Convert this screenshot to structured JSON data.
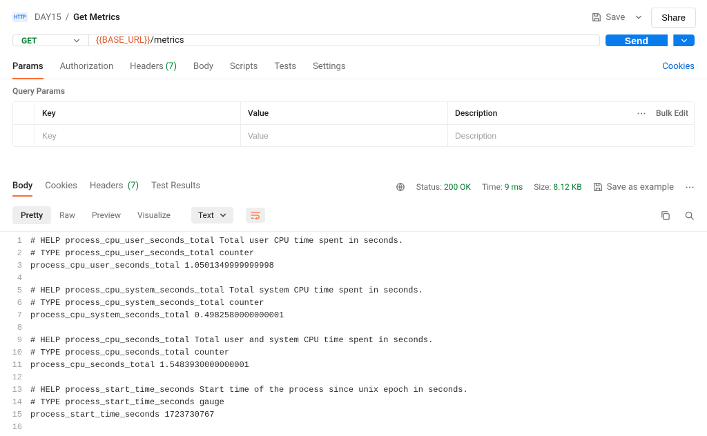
{
  "breadcrumb": {
    "parent": "DAY15",
    "current": "Get Metrics"
  },
  "top_actions": {
    "save": "Save",
    "share": "Share"
  },
  "request": {
    "method": "GET",
    "url_var": "{{BASE_URL}}",
    "url_path": "/metrics",
    "send": "Send"
  },
  "primary_tabs": {
    "params": "Params",
    "authorization": "Authorization",
    "headers": "Headers",
    "headers_count": "(7)",
    "body": "Body",
    "scripts": "Scripts",
    "tests": "Tests",
    "settings": "Settings"
  },
  "cookies_link": "Cookies",
  "qp": {
    "heading": "Query Params",
    "key": "Key",
    "value": "Value",
    "description": "Description",
    "bulk_edit": "Bulk Edit",
    "ph_key": "Key",
    "ph_value": "Value",
    "ph_desc": "Description"
  },
  "response_tabs": {
    "body": "Body",
    "cookies": "Cookies",
    "headers": "Headers",
    "headers_count": "(7)",
    "test_results": "Test Results"
  },
  "response_meta": {
    "status_label": "Status:",
    "status_value": "200 OK",
    "time_label": "Time:",
    "time_value": "9 ms",
    "size_label": "Size:",
    "size_value": "8.12 KB",
    "save_example": "Save as example"
  },
  "response_toolbar": {
    "pretty": "Pretty",
    "raw": "Raw",
    "preview": "Preview",
    "visualize": "Visualize",
    "mode": "Text"
  },
  "body_lines": [
    "# HELP process_cpu_user_seconds_total Total user CPU time spent in seconds.",
    "# TYPE process_cpu_user_seconds_total counter",
    "process_cpu_user_seconds_total 1.0501349999999998",
    "",
    "# HELP process_cpu_system_seconds_total Total system CPU time spent in seconds.",
    "# TYPE process_cpu_system_seconds_total counter",
    "process_cpu_system_seconds_total 0.4982580000000001",
    "",
    "# HELP process_cpu_seconds_total Total user and system CPU time spent in seconds.",
    "# TYPE process_cpu_seconds_total counter",
    "process_cpu_seconds_total 1.5483930000000001",
    "",
    "# HELP process_start_time_seconds Start time of the process since unix epoch in seconds.",
    "# TYPE process_start_time_seconds gauge",
    "process_start_time_seconds 1723730767",
    ""
  ]
}
